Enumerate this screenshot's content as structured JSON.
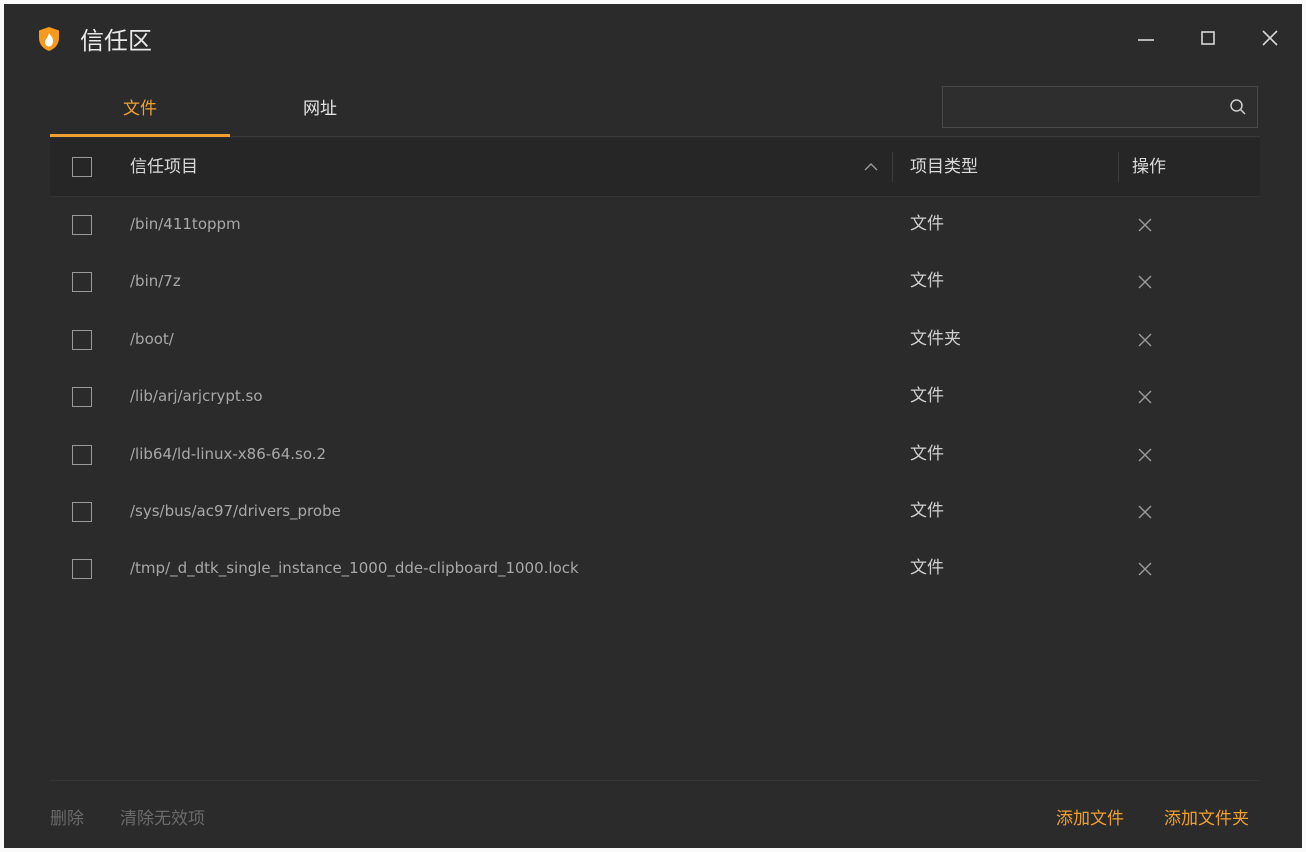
{
  "window": {
    "title": "信任区"
  },
  "tabs": [
    {
      "label": "文件",
      "active": true
    },
    {
      "label": "网址",
      "active": false
    }
  ],
  "search": {
    "value": "",
    "placeholder": ""
  },
  "table": {
    "headers": {
      "name": "信任项目",
      "type": "项目类型",
      "operation": "操作"
    },
    "rows": [
      {
        "path": "/bin/411toppm",
        "type": "文件"
      },
      {
        "path": "/bin/7z",
        "type": "文件"
      },
      {
        "path": "/boot/",
        "type": "文件夹"
      },
      {
        "path": "/lib/arj/arjcrypt.so",
        "type": "文件"
      },
      {
        "path": "/lib64/ld-linux-x86-64.so.2",
        "type": "文件"
      },
      {
        "path": "/sys/bus/ac97/drivers_probe",
        "type": "文件"
      },
      {
        "path": "/tmp/_d_dtk_single_instance_1000_dde-clipboard_1000.lock",
        "type": "文件"
      }
    ]
  },
  "footer": {
    "delete": "删除",
    "clear_invalid": "清除无效项",
    "add_file": "添加文件",
    "add_folder": "添加文件夹"
  },
  "colors": {
    "accent": "#f0a030",
    "background": "#2b2b2b"
  },
  "icons": [
    "shield-logo-icon",
    "minimize-icon",
    "maximize-icon",
    "close-icon",
    "search-icon",
    "sort-up-icon",
    "delete-x-icon",
    "checkbox"
  ]
}
